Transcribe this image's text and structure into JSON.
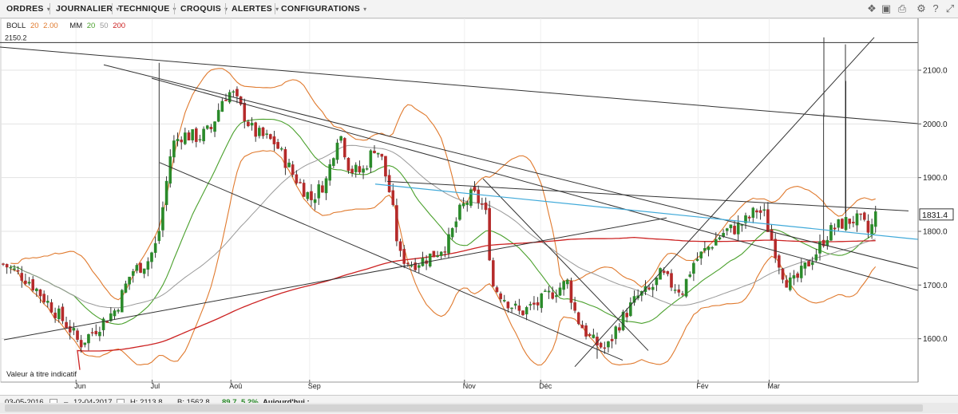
{
  "menu": {
    "items": [
      {
        "label": "ORDRES"
      },
      {
        "label": "JOURNALIER"
      },
      {
        "label": "TECHNIQUE"
      },
      {
        "label": "CROQUIS"
      },
      {
        "label": "ALERTES"
      },
      {
        "label": "CONFIGURATIONS"
      }
    ],
    "tools": [
      {
        "icon": "layers-icon",
        "glyph": "❖"
      },
      {
        "icon": "image-icon",
        "glyph": "▣"
      },
      {
        "icon": "print-icon",
        "glyph": "⎙"
      },
      {
        "icon": "gear-icon",
        "glyph": "⚙"
      },
      {
        "icon": "help-icon",
        "glyph": "?"
      },
      {
        "icon": "fullscreen-icon",
        "glyph": "⤢"
      }
    ]
  },
  "indicators": {
    "boll_name": "BOLL",
    "boll_params": [
      "20",
      "2.00"
    ],
    "mm_name": "MM",
    "mm_periods": [
      "20",
      "50",
      "200"
    ]
  },
  "colors": {
    "boll": "#e07a2e",
    "mm20": "#4aa02c",
    "mm50": "#999999",
    "mm200": "#cc2222",
    "up": "#2a8a2a",
    "down": "#b52a2a",
    "trend": "#333333",
    "cyan": "#3fa9d9",
    "grid": "#e3e3e3"
  },
  "status": {
    "disclaimer": "Valeur à titre indicatif",
    "date_from": "03-05-2016",
    "date_to": "12-04-2017",
    "high": "H: 2113.8",
    "low": "B: 1562.8",
    "change": "89.7",
    "change_pct": "5.2%",
    "today": "Aujourd'hui :"
  },
  "chart_data": {
    "type": "candlestick",
    "y_ticks": [
      "2100.0",
      "2000.0",
      "1900.0",
      "1800.0",
      "1700.0",
      "1600.0"
    ],
    "top_label": "2150.2",
    "last_price": "1831.4",
    "months": [
      "Jun",
      "Jul",
      "Aoû",
      "Sep",
      "Nov",
      "Déc",
      "Fév",
      "Mar"
    ],
    "ylim": [
      1560,
      2160
    ],
    "date_range": [
      "2016-05-03",
      "2017-04-12"
    ],
    "grid": true,
    "high": 2113.8,
    "low": 1562.8,
    "last": 1831.4
  }
}
